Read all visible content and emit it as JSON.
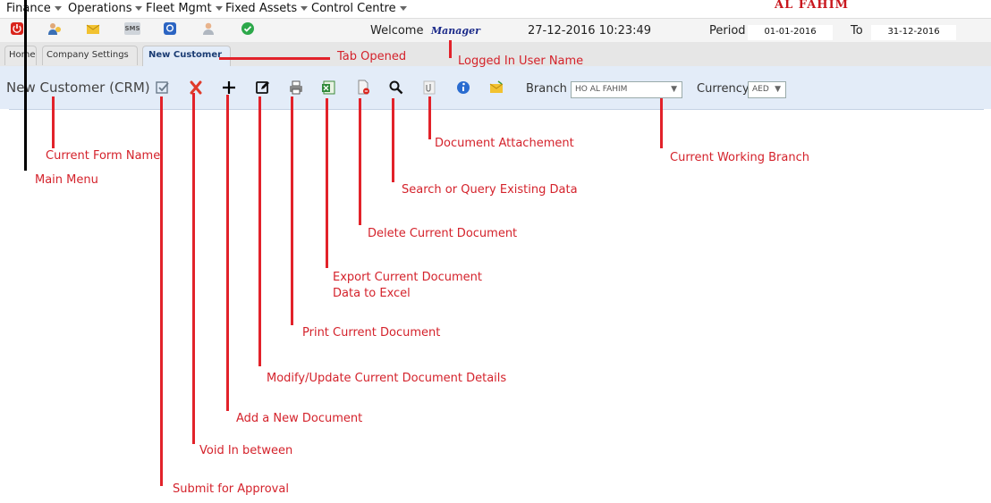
{
  "menu": {
    "items": [
      {
        "label": "Finance"
      },
      {
        "label": "Operations"
      },
      {
        "label": "Fleet Mgmt"
      },
      {
        "label": "Fixed Assets"
      },
      {
        "label": "Control Centre"
      }
    ]
  },
  "brand": "AL FAHIM",
  "quickbar": {
    "icons": [
      "power-icon",
      "users-icon",
      "mail-icon",
      "sms-icon",
      "chat-icon",
      "user-icon",
      "check-icon"
    ],
    "sms_text": "SMS",
    "welcome_label": "Welcome",
    "user_name": "Manager",
    "datetime": "27-12-2016 10:23:49",
    "period_label": "Period",
    "period_from": "01-01-2016",
    "to_label": "To",
    "period_to": "31-12-2016"
  },
  "tabs": [
    {
      "label": "Home"
    },
    {
      "label": "Company Settings"
    },
    {
      "label": "New Customer"
    }
  ],
  "form": {
    "title": "New Customer (CRM)",
    "branch_label": "Branch",
    "branch_value": "HO AL FAHIM",
    "currency_label": "Currency",
    "currency_value": "AED"
  },
  "annotations": {
    "tab_opened": "Tab Opened",
    "logged_user": "Logged In User Name",
    "form_name": "Current Form Name",
    "main_menu": "Main Menu",
    "attachment": "Document Attachement",
    "branch": "Current Working Branch",
    "search": "Search or Query Existing Data",
    "delete": "Delete Current Document",
    "export_line1": "Export Current Document",
    "export_line2": "Data to Excel",
    "print": "Print Current Document",
    "modify": "Modify/Update Current Document Details",
    "add": "Add a New Document",
    "void": "Void In between",
    "submit": "Submit for Approval"
  },
  "colors": {
    "annotation": "#e2222a",
    "brand": "#c8161d",
    "form_bar": "#e3ecf8"
  }
}
